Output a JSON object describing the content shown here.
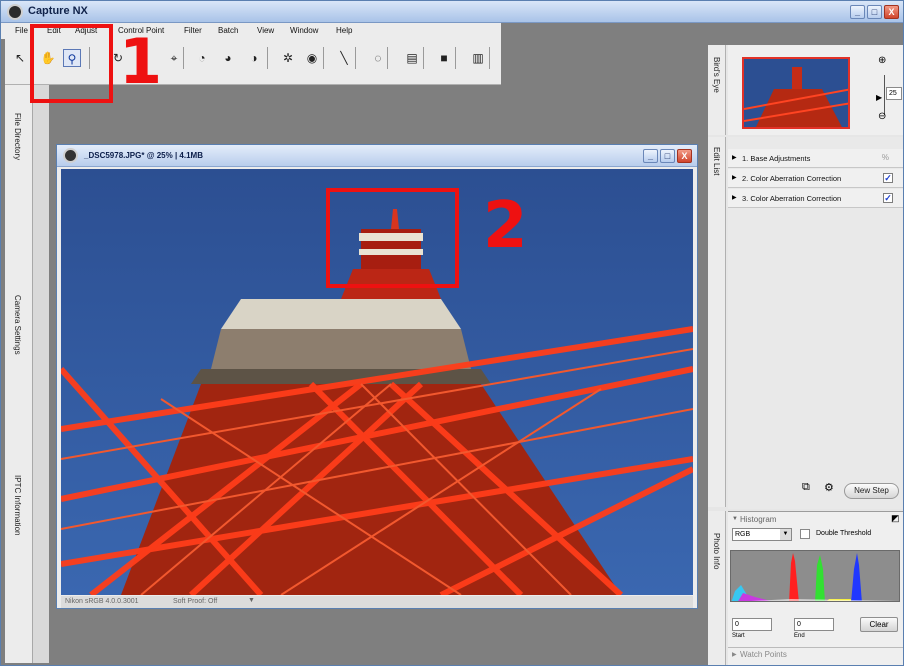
{
  "app": {
    "title": "Capture NX",
    "window_buttons": [
      "_",
      "□",
      "X"
    ]
  },
  "menu": {
    "items": [
      "File",
      "Edit",
      "Adjust",
      "Control Point",
      "Filter",
      "Batch",
      "View",
      "Window",
      "Help"
    ]
  },
  "toolbar": {
    "tools": [
      "select-arrow",
      "hand",
      "zoom",
      "rotate",
      "straighten",
      "crop",
      "brush",
      "dodge",
      "burn",
      "control-point",
      "white-point",
      "black-point",
      "gradient",
      "lasso",
      "marquee",
      "fill"
    ]
  },
  "left_tabs": [
    "File Directory",
    "Camera Settings",
    "IPTC Information"
  ],
  "document": {
    "title": "_DSC5978.JPG* @ 25% | 4.1MB",
    "profile": "Nikon sRGB 4.0.0.3001",
    "soft_proof": "Soft Proof: Off"
  },
  "birds_eye": {
    "tab_label": "Bird's Eye",
    "zoom_value": "25"
  },
  "edit_list": {
    "tab_label": "Edit List",
    "steps": [
      {
        "label": "1. Base Adjustments",
        "checked": false
      },
      {
        "label": "2. Color Aberration Correction",
        "checked": true
      },
      {
        "label": "3. Color Aberration Correction",
        "checked": true
      }
    ],
    "new_step_label": "New Step"
  },
  "photo_info": {
    "tab_label": "Photo Info",
    "histogram_label": "Histogram",
    "channel": "RGB",
    "double_threshold_label": "Double Threshold",
    "start_value": "0",
    "end_value": "0",
    "start_label": "Start",
    "end_label": "End",
    "clear_label": "Clear",
    "watch_points_label": "Watch Points"
  },
  "annotations": {
    "label_1": "1",
    "label_2": "2",
    "color": "#ee1111"
  }
}
